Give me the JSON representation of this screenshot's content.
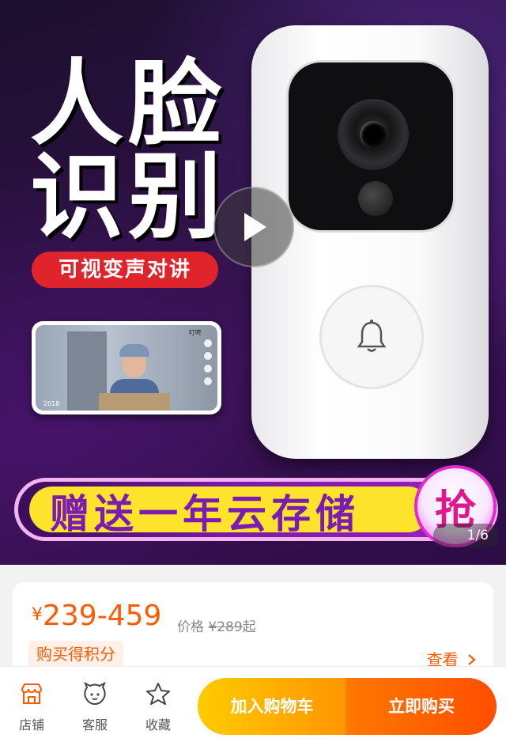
{
  "hero": {
    "headline_line1": "人脸",
    "headline_line2": "识别",
    "feature_tag": "可视变声对讲",
    "banner_text": "赠送一年云存储",
    "grab_label": "抢",
    "media_counter": "1/6",
    "phone_top_text": "叮咚",
    "phone_tag": "2018"
  },
  "product": {
    "currency": "¥",
    "price_range": "239-459",
    "original_label": "价格",
    "original_currency": "¥",
    "original_price": "289",
    "original_suffix": "起",
    "points_label": "购买得积分",
    "view_label": "查看"
  },
  "bottom_bar": {
    "store_label": "店铺",
    "service_label": "客服",
    "favorite_label": "收藏",
    "add_cart_label": "加入购物车",
    "buy_now_label": "立即购买"
  },
  "colors": {
    "accent": "#ff5a00",
    "cart": "#ffb400",
    "buy": "#ff5a00"
  }
}
